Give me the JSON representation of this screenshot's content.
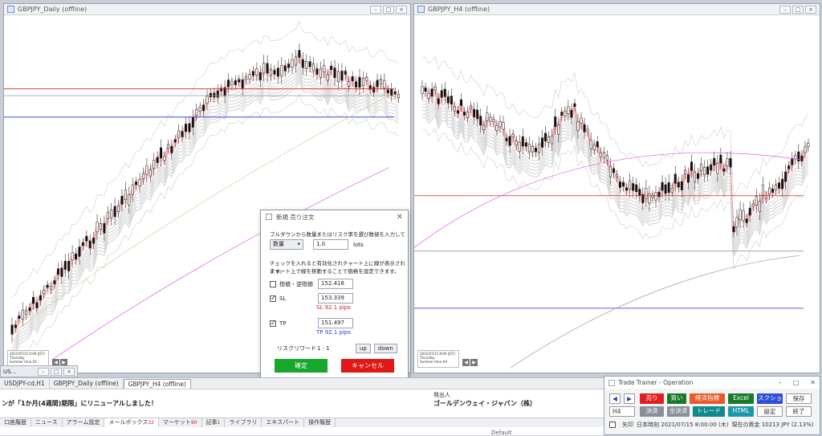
{
  "windows": {
    "left": {
      "title": "GBPJPY_Daily (offline)",
      "info": [
        "2021/07/15 0:00 (JST)",
        "Thursday",
        "Summer time  D1"
      ]
    },
    "right": {
      "title": "GBPJPY_H4 (offline)",
      "info": [
        "2021/07/15 8:00 (JST)",
        "Thursday",
        "Summer time  H4"
      ]
    }
  },
  "dialog": {
    "title": "新規 売り注文",
    "instruction": "プルダウンから数量またはリスク率を選び数値を入力してください。",
    "quantity_select": "数量",
    "quantity_value": "1.0",
    "quantity_unit": "lots",
    "chart_note_1": "チェックを入れると有効化されチャート上に線が表示されます。",
    "chart_note_2": "チャート上で線を移動することで価格を設定できます。",
    "limit_label": "指値・逆指値",
    "limit_value": "152.418",
    "sl_label": "SL",
    "sl_value": "153.339",
    "sl_pips": "SL 92.1 pips",
    "tp_label": "TP",
    "tp_value": "151.497",
    "tp_pips": "TP 92.1 pips",
    "risk_reward_label": "リスクリワード",
    "risk_reward_value": "1 : 1",
    "up_label": "up",
    "down_label": "down",
    "confirm_label": "確定",
    "cancel_label": "キャンセル",
    "sl_color": "#d62020",
    "tp_color": "#2040d0"
  },
  "terminal": {
    "mini_title": "US...",
    "tabs": [
      "USDJPY-cd,H1",
      "GBPJPY_Daily (offline)",
      "GBPJPY_H4 (offline)"
    ],
    "news_header": "発出人",
    "news_line": "ンが「1か月(4週間)期限」にリニューアルしました！",
    "news_sender": "ゴールデンウェイ・ジャパン（株）",
    "news_default": "Default",
    "bottom_tabs": [
      {
        "label": "口座履歴",
        "badge": ""
      },
      {
        "label": "ニュース",
        "badge": ""
      },
      {
        "label": "アラーム設定",
        "badge": ""
      },
      {
        "label": "メールボックス",
        "badge": "32"
      },
      {
        "label": "マーケット",
        "badge": "90"
      },
      {
        "label": "記事",
        "badge": "1"
      },
      {
        "label": "ライブラリ",
        "badge": ""
      },
      {
        "label": "エキスパート",
        "badge": ""
      },
      {
        "label": "操作履歴",
        "badge": ""
      }
    ]
  },
  "trainer": {
    "title": "Trade Trainer - Operation",
    "prev_label": "◀",
    "next_label": "▶",
    "sell_label": "売り",
    "buy_label": "買い",
    "limit_label": "経済指標",
    "excel_label": "Excel",
    "screenshot_label": "スクショ",
    "save_label": "保存",
    "timeframe": "H4",
    "settle_label": "決済",
    "settle_all_label": "全決済",
    "trade_label": "トレード",
    "html_label": "HTML",
    "settings_label": "設定",
    "exit_label": "終了",
    "arrow_label": "矢印",
    "time_text": "日本時刻 2021/07/15 8:00:00 (木)",
    "balance_text": "現在の資金 10213 JPY (2.13%)"
  }
}
